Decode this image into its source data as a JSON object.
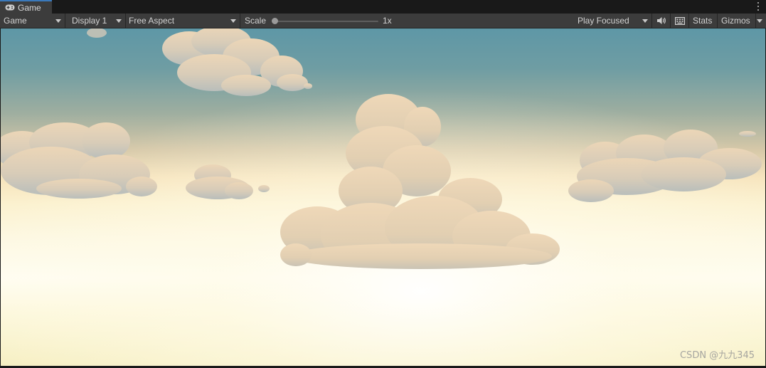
{
  "tab": {
    "label": "Game",
    "icon": "gamepad-icon"
  },
  "toolbar": {
    "view_select": "Game",
    "display_select": "Display 1",
    "aspect_select": "Free Aspect",
    "scale_label": "Scale",
    "scale_value": "1x",
    "scale_fraction": 0.0,
    "play_mode_select": "Play Focused",
    "audio_icon": "speaker-icon",
    "stats_icon": "keyboard-grid-icon",
    "stats_label": "Stats",
    "gizmos_label": "Gizmos"
  },
  "scene": {
    "watermark": "CSDN @九九345"
  },
  "colors": {
    "panel_bg": "#3c3c3c",
    "window_bg": "#191919",
    "tab_accent": "#3a79bb",
    "text": "#d2d2d2",
    "sky_top": "#5e97a6",
    "sky_horizon": "#fffdf2",
    "cloud": "#cfc7b8"
  }
}
